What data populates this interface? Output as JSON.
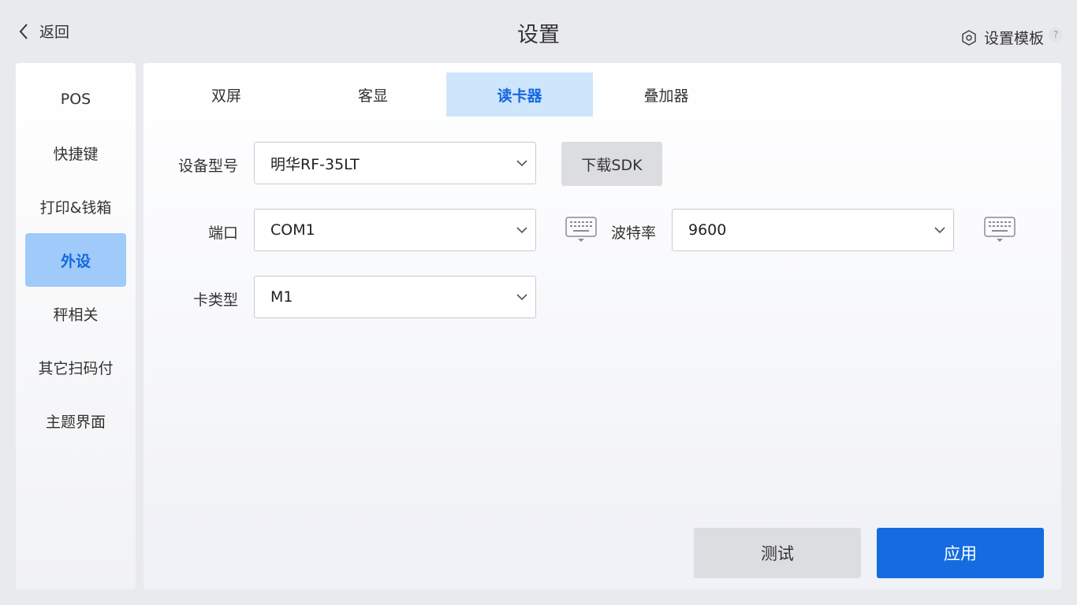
{
  "header": {
    "back_label": "返回",
    "title": "设置",
    "template_label": "设置模板",
    "help_mark": "?"
  },
  "sidebar": {
    "items": [
      {
        "label": "POS"
      },
      {
        "label": "快捷键"
      },
      {
        "label": "打印&钱箱"
      },
      {
        "label": "外设",
        "active": true
      },
      {
        "label": "秤相关"
      },
      {
        "label": "其它扫码付"
      },
      {
        "label": "主题界面"
      }
    ]
  },
  "tabs": [
    {
      "label": "双屏"
    },
    {
      "label": "客显"
    },
    {
      "label": "读卡器",
      "active": true
    },
    {
      "label": "叠加器"
    }
  ],
  "form": {
    "device_model": {
      "label": "设备型号",
      "value": "明华RF-35LT"
    },
    "download_sdk_label": "下载SDK",
    "port": {
      "label": "端口",
      "value": "COM1"
    },
    "baud_rate": {
      "label": "波特率",
      "value": "9600"
    },
    "card_type": {
      "label": "卡类型",
      "value": "M1"
    }
  },
  "footer": {
    "test_label": "测试",
    "apply_label": "应用"
  },
  "colors": {
    "accent": "#146ce0",
    "active_bg": "#9fcafa",
    "tab_active_bg": "#cfe5fb",
    "button_gray": "#dcdde1"
  }
}
